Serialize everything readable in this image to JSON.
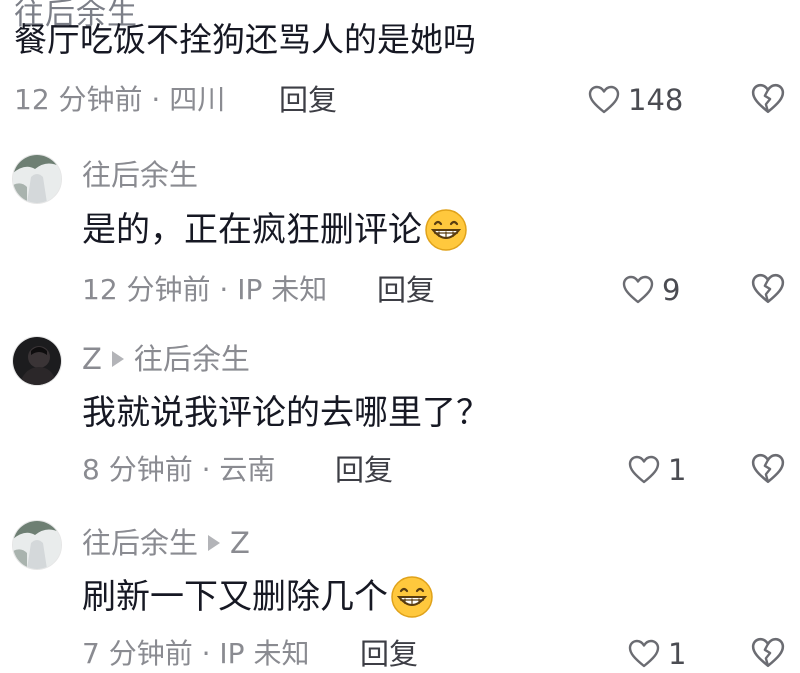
{
  "top_comment": {
    "partial_header": "往后余生",
    "text": "餐厅吃饭不拴狗还骂人的是她吗",
    "time": "12 分钟前 · 四川",
    "reply_label": "回复",
    "likes": "148"
  },
  "replies": [
    {
      "username": "往后余生",
      "reply_to": "",
      "text": "是的，正在疯狂删评论",
      "emoji": "grin",
      "time": "12 分钟前 · IP 未知",
      "reply_label": "回复",
      "likes": "9"
    },
    {
      "username": "Z",
      "reply_to": "往后余生",
      "text": "我就说我评论的去哪里了？",
      "emoji": "",
      "time": "8 分钟前 · 云南",
      "reply_label": "回复",
      "likes": "1"
    },
    {
      "username": "往后余生",
      "reply_to": "Z",
      "text": "刷新一下又删除几个",
      "emoji": "grin",
      "time": "7 分钟前 · IP 未知",
      "reply_label": "回复",
      "likes": "1"
    }
  ],
  "icons": {
    "like": "heart-outline-icon",
    "dislike": "broken-heart-icon",
    "reply_arrow": "play-arrow-icon",
    "emoji": "grin-emoji-icon"
  },
  "colors": {
    "primary_text": "#161823",
    "secondary_text": "#8a8b91",
    "emoji_yellow": "#ffc83d"
  }
}
